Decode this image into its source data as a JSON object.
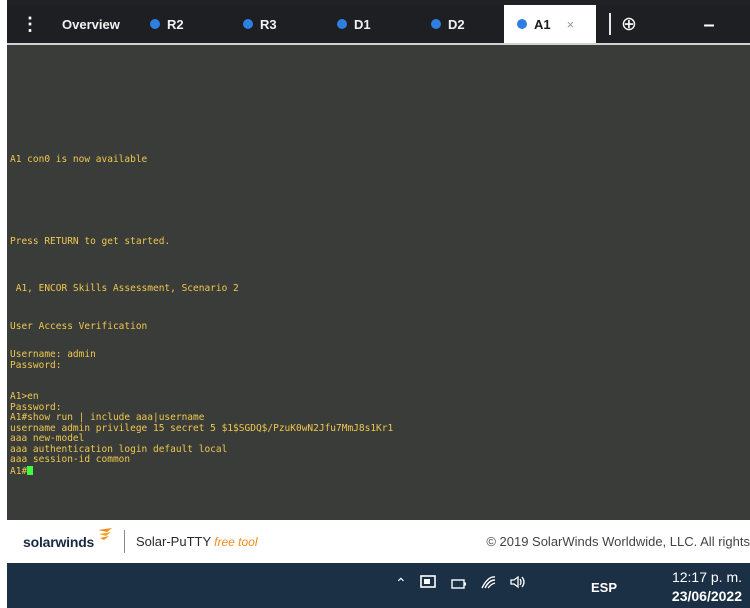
{
  "tabs": {
    "menu_icon": "menu-vertical-dots-icon",
    "items": [
      {
        "label": "Overview",
        "dot": false
      },
      {
        "label": "R2",
        "dot": true
      },
      {
        "label": "R3",
        "dot": true
      },
      {
        "label": "D1",
        "dot": true
      },
      {
        "label": "D2",
        "dot": true
      },
      {
        "label": "A1",
        "dot": true,
        "active": true,
        "close": "×"
      }
    ],
    "add_icon": "⊕",
    "minimize_icon": "–",
    "dot_color": "#2f7fe3"
  },
  "terminal": {
    "lines": [
      "A1 con0 is now available",
      "Press RETURN to get started.",
      " A1, ENCOR Skills Assessment, Scenario 2",
      "User Access Verification",
      "Username: admin",
      "Password:",
      "A1>en",
      "Password:",
      "A1#show run | include aaa|username",
      "username admin privilege 15 secret 5 $1$SGDQ$/PzuK0wN2Jfu7MmJ8s1Kr1",
      "aaa new-model",
      "aaa authentication login default local",
      "aaa session-id common",
      "A1#"
    ],
    "text_color": "#efc84f",
    "background": "#3a3c39",
    "cursor_color": "#3dff3d"
  },
  "footer": {
    "logo": "solarwinds",
    "product": "Solar-PuTTY",
    "product_tag": "free tool",
    "copyright": "© 2019 SolarWinds Worldwide, LLC. All rights"
  },
  "taskbar": {
    "icons": [
      "chevron-up-icon",
      "meet-now-icon",
      "battery-icon",
      "wifi-icon",
      "volume-icon"
    ],
    "language": "ESP",
    "time": "12:17 p. m.",
    "date": "23/06/2022"
  }
}
